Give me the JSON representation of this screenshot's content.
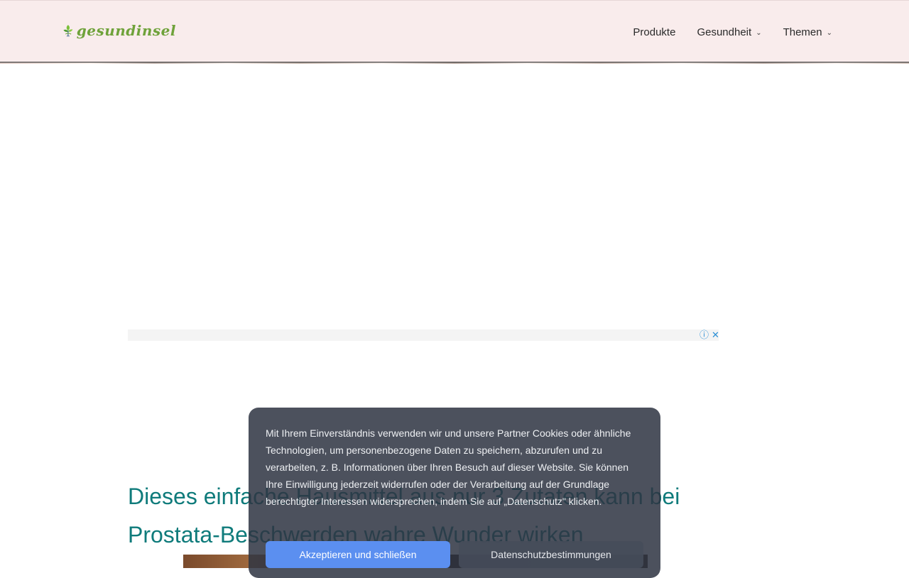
{
  "header": {
    "logo_text": "gesundinsel",
    "nav": [
      {
        "label": "Produkte",
        "has_dropdown": false
      },
      {
        "label": "Gesundheit",
        "has_dropdown": true
      },
      {
        "label": "Themen",
        "has_dropdown": true
      }
    ]
  },
  "ad": {
    "info_icon": "ⓘ",
    "close_icon": "✕"
  },
  "article": {
    "title": "Dieses einfache Hausmittel aus nur 3 Zutaten kann bei Prostata-Beschwerden wahre Wunder wirken"
  },
  "cookie_banner": {
    "text": "Mit Ihrem Einverständnis verwenden wir und unsere Partner Cookies oder ähnliche Technologien, um personenbezogene Daten zu speichern, abzurufen und zu verarbeiten, z. B. Informationen über Ihren Besuch auf dieser Website. Sie können Ihre Einwilligung jederzeit widerrufen oder der Verarbeitung auf der Grundlage berechtigter Interessen widersprechen, indem Sie auf „Datenschutz\" klicken.",
    "accept_label": "Akzeptieren und schließen",
    "privacy_label": "Datenschutzbestimmungen"
  },
  "colors": {
    "header_bg": "#f9ecec",
    "title": "#0f7b7b",
    "accept_button": "#5b8ff0",
    "logo_green": "#6fa23a"
  }
}
